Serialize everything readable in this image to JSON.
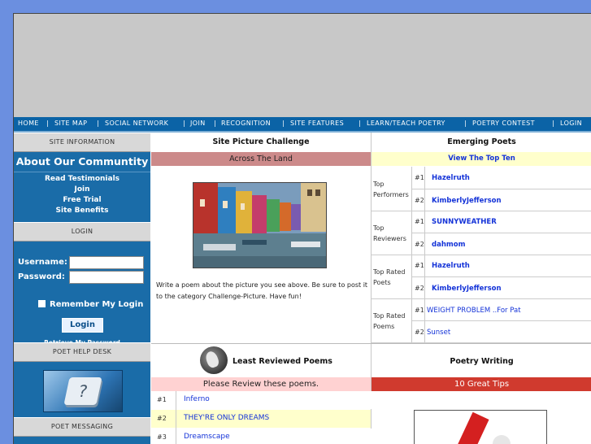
{
  "nav": [
    "HOME",
    "SITE MAP",
    "SOCIAL NETWORK",
    "JOIN",
    "RECOGNITION",
    "SITE FEATURES",
    "LEARN/TEACH POETRY",
    "POETRY CONTEST",
    "LOGIN"
  ],
  "sidebar": {
    "site_info": "SITE INFORMATION",
    "about": "About Our Communtity",
    "links": [
      "Read Testimonials",
      "Join",
      "Free Trial",
      "Site Benefits"
    ],
    "login_header": "LOGIN",
    "username_label": "Username:",
    "password_label": "Password:",
    "remember": "Remember My Login",
    "login_button": "Login",
    "retrieve": "Retrieve My Password",
    "help_header": "POET HELP DESK",
    "messaging_header": "POET MESSAGING"
  },
  "challenge": {
    "header": "Site Picture Challenge",
    "subheader": "Across The Land",
    "text": "Write a poem about the picture you see above. Be sure to post it to the category Challenge-Picture. Have fun!"
  },
  "emerging": {
    "header": "Emerging Poets",
    "view_top": "View The Top Ten",
    "groups": [
      {
        "label": "Top Performers",
        "entries": [
          {
            "rank": "#1",
            "name": "Hazelruth"
          },
          {
            "rank": "#2",
            "name": "KimberlyJefferson"
          }
        ]
      },
      {
        "label": "Top Reviewers",
        "entries": [
          {
            "rank": "#1",
            "name": "SUNNYWEATHER"
          },
          {
            "rank": "#2",
            "name": "dahmom"
          }
        ]
      },
      {
        "label": "Top Rated Poets",
        "entries": [
          {
            "rank": "#1",
            "name": "Hazelruth"
          },
          {
            "rank": "#2",
            "name": "KimberlyJefferson"
          }
        ]
      },
      {
        "label": "Top Rated Poems",
        "entries": [
          {
            "rank": "#1",
            "name": "WEIGHT PROBLEM ..For Pat"
          },
          {
            "rank": "#2",
            "name": "Sunset"
          }
        ]
      }
    ]
  },
  "least_reviewed": {
    "header": "Least Reviewed Poems",
    "subheader": "Please Review these poems.",
    "items": [
      {
        "rank": "#1",
        "title": "Inferno"
      },
      {
        "rank": "#2",
        "title": "THEY'RE ONLY DREAMS"
      },
      {
        "rank": "#3",
        "title": "Dreamscape"
      }
    ]
  },
  "poetry_writing": {
    "header": "Poetry Writing",
    "subheader": "10 Great Tips"
  }
}
